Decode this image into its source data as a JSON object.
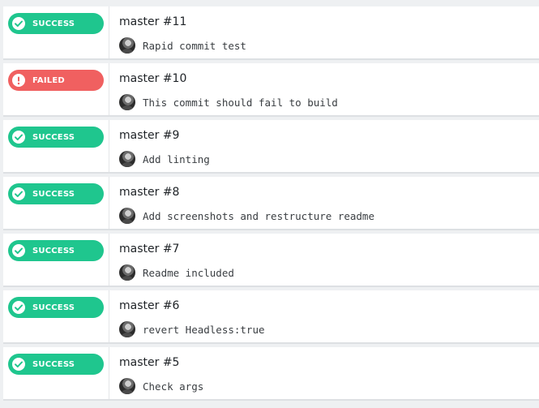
{
  "status_colors": {
    "success": "#1fc68e",
    "failed": "#f06060"
  },
  "builds": [
    {
      "status": "SUCCESS",
      "status_icon": "check-circle-icon",
      "title": "master #11",
      "commit": "Rapid commit test"
    },
    {
      "status": "FAILED",
      "status_icon": "exclamation-circle-icon",
      "title": "master #10",
      "commit": "This commit should fail to build"
    },
    {
      "status": "SUCCESS",
      "status_icon": "check-circle-icon",
      "title": "master #9",
      "commit": "Add linting"
    },
    {
      "status": "SUCCESS",
      "status_icon": "check-circle-icon",
      "title": "master #8",
      "commit": "Add screenshots and restructure readme"
    },
    {
      "status": "SUCCESS",
      "status_icon": "check-circle-icon",
      "title": "master #7",
      "commit": "Readme included"
    },
    {
      "status": "SUCCESS",
      "status_icon": "check-circle-icon",
      "title": "master #6",
      "commit": "revert Headless:true"
    },
    {
      "status": "SUCCESS",
      "status_icon": "check-circle-icon",
      "title": "master #5",
      "commit": "Check args"
    }
  ]
}
